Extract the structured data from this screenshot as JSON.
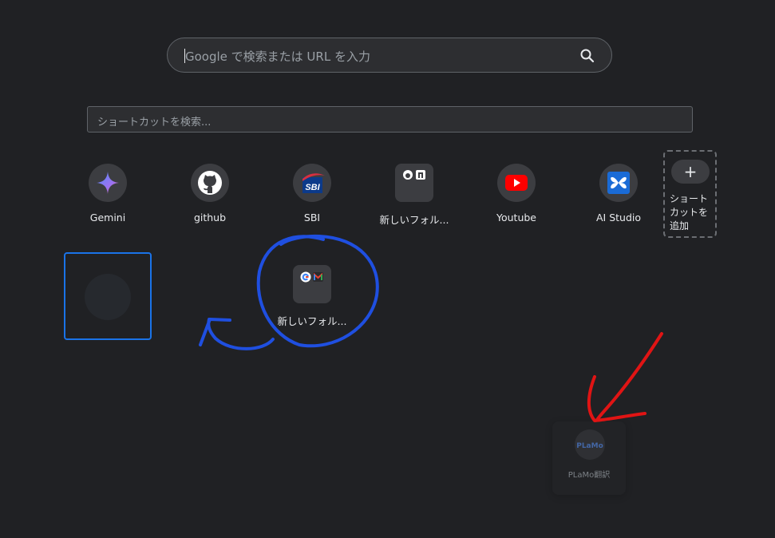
{
  "search": {
    "placeholder": "Google で検索または URL を入力"
  },
  "filter": {
    "placeholder": "ショートカットを検索..."
  },
  "shortcuts": [
    {
      "label": "Gemini",
      "icon": "gemini-icon"
    },
    {
      "label": "github",
      "icon": "github-icon"
    },
    {
      "label": "SBI",
      "icon": "sbi-icon"
    },
    {
      "label": "新しいフォル...",
      "icon": "folder-icon"
    },
    {
      "label": "Youtube",
      "icon": "youtube-icon"
    },
    {
      "label": "AI Studio",
      "icon": "ai-studio-icon"
    }
  ],
  "add_shortcut": {
    "label": "ショートカットを追加"
  },
  "dragged_folder": {
    "label": "新しいフォル...",
    "icon": "folder-icon"
  },
  "ghost_tile": {
    "label": "PLaMo翻訳",
    "icon": "plamo-icon"
  },
  "sbi_text": "SBI",
  "plamo_text": "PLaMo",
  "annotation_colors": {
    "blue": "#1f4fe0",
    "red": "#e01414"
  }
}
